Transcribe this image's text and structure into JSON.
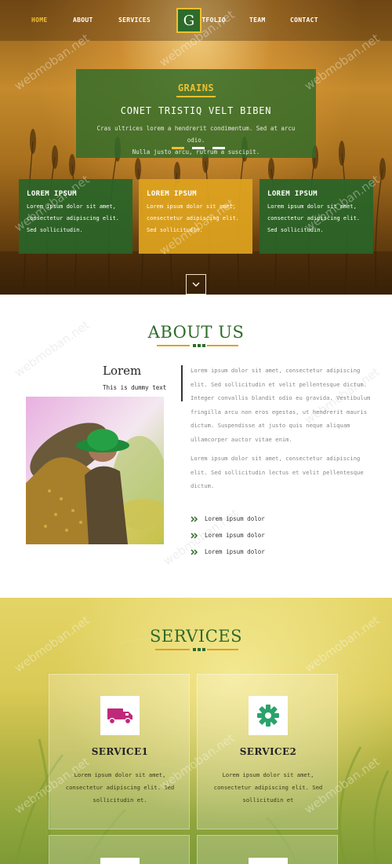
{
  "nav": {
    "items": [
      {
        "label": "HOME",
        "active": true
      },
      {
        "label": "ABOUT",
        "active": false
      },
      {
        "label": "SERVICES",
        "active": false
      },
      {
        "label": "PORTFOLIO",
        "active": false
      },
      {
        "label": "TEAM",
        "active": false
      },
      {
        "label": "CONTACT",
        "active": false
      }
    ],
    "logo_letter": "G"
  },
  "banner": {
    "label": "GRAINS",
    "heading": "CONET TRISTIQ VELT BIBEN",
    "text_line1": "Cras ultrices lorem a hendrerit condimentum. Sed at arcu odio.",
    "text_line2": "Nulla justo arcu, rutrum a suscipit."
  },
  "features": [
    {
      "title": "LOREM IPSUM",
      "line1": "Lorem ipsum dolor sit amet,",
      "line2": "consectetur adipiscing elit.",
      "line3": "Sed sollicitudin."
    },
    {
      "title": "LOREM IPSUM",
      "line1": "Lorem ipsum dolor sit amet,",
      "line2": "consectetur adipiscing elit.",
      "line3": "Sed sollicitudin."
    },
    {
      "title": "LOREM IPSUM",
      "line1": "Lorem ipsum dolor sit amet,",
      "line2": "consectetur adipiscing elit.",
      "line3": "Sed sollicitudin."
    }
  ],
  "watermark": "webmoban.net",
  "about": {
    "title": "ABOUT US",
    "name": "Lorem",
    "subtitle": "This is dummy text",
    "para1": "Lorem ipsum dolor sit amet, consectetur adipiscing elit. Sed sollicitudin et velit pellentesque dictum. Integer convallis blandit odio eu gravida. Vestibulum fringilla arcu non eros egestas, ut hendrerit mauris dictum. Suspendisse at justo quis neque aliquam ullamcorper auctor vitae enim.",
    "para2": "Lorem ipsum dolor sit amet, consectetur adipiscing elit. Sed sollicitudin lectus et velit pellentesque dictum.",
    "list": [
      "Lorem ipsum dolor",
      "Lorem ipsum dolor",
      "Lorem ipsum dolor"
    ]
  },
  "services": {
    "title": "SERVICES",
    "cards": [
      {
        "icon": "truck-icon",
        "title": "SERVICE1",
        "text": "Lorem ipsum dolor sit amet, consectetur adipiscing elit. Sed sollicitudin et."
      },
      {
        "icon": "gear-icon",
        "title": "SERVICE2",
        "text": "Lorem ipsum dolor sit amet, consectetur adipiscing elit. Sed sollicitudin et"
      }
    ]
  },
  "colors": {
    "brand_green": "#2e6b2a",
    "brand_gold": "#f0c030",
    "truck_icon": "#c0297a",
    "gear_icon": "#2aa36a"
  }
}
